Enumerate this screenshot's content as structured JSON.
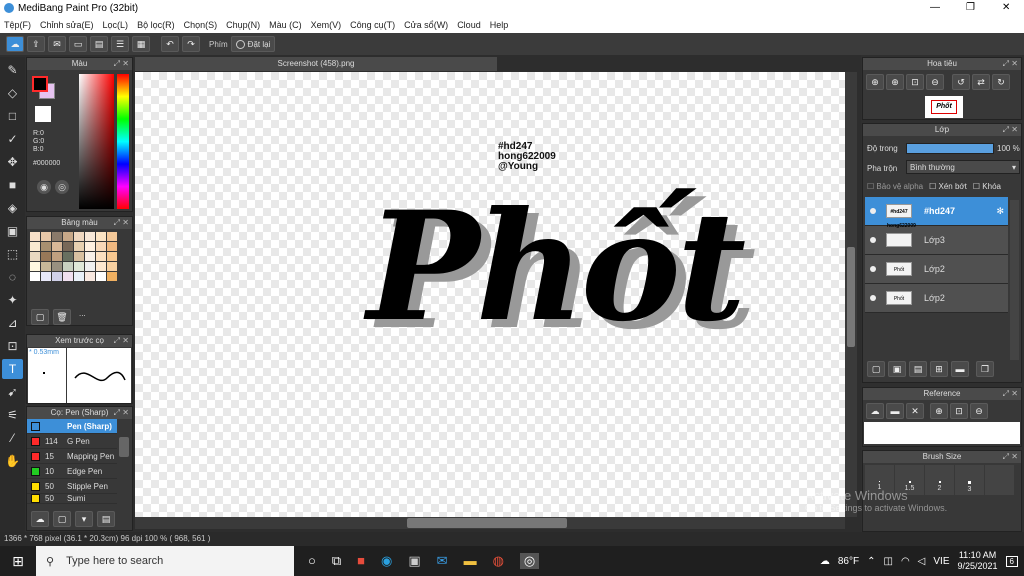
{
  "window": {
    "title": "MediBang Paint Pro (32bit)",
    "controls": [
      "—",
      "❐",
      "✕"
    ]
  },
  "menu": [
    "Tệp(F)",
    "Chỉnh sửa(E)",
    "Lọc(L)",
    "Bộ lọc(R)",
    "Chọn(S)",
    "Chụp(N)",
    "Màu (C)",
    "Xem(V)",
    "Công cụ(T)",
    "Cửa sổ(W)",
    "Cloud",
    "Help"
  ],
  "toolbar": {
    "shortcut_label": "Phím",
    "reset_label": "Đặt lại"
  },
  "color_panel": {
    "title": "Màu",
    "r": "R:0",
    "g": "G:0",
    "b": "B:0",
    "hex": "#000000"
  },
  "palette_panel": {
    "title": "Bảng màu",
    "more": "..."
  },
  "brush_preview": {
    "title": "Xem trước cọ",
    "size": "0.53mm"
  },
  "brush_panel": {
    "title": "Cọ: Pen (Sharp)",
    "items": [
      {
        "size": "",
        "name": "Pen (Sharp)",
        "color": "#ff2a2a"
      },
      {
        "size": "114",
        "name": "G Pen",
        "color": "#ff2a2a"
      },
      {
        "size": "15",
        "name": "Mapping Pen",
        "color": "#ff2a2a"
      },
      {
        "size": "10",
        "name": "Edge Pen",
        "color": "#22cc22"
      },
      {
        "size": "50",
        "name": "Stipple Pen",
        "color": "#ffdd00"
      },
      {
        "size": "50",
        "name": "Sumi",
        "color": "#ffdd00"
      }
    ]
  },
  "document": {
    "tab": "Screenshot (458).png",
    "credit_line1": "#hd247",
    "credit_line2": "hong622009",
    "credit_line3": "@Young",
    "artwork_text": "Phốt"
  },
  "navigator": {
    "title": "Hoa tiêu",
    "thumb_text": "Phốt"
  },
  "layer_panel": {
    "title": "Lớp",
    "opacity_label": "Độ trong",
    "opacity_value": "100 %",
    "opacity": 1.0,
    "blend_label": "Pha trộn",
    "blend_value": "Bình thường",
    "protect_alpha": "Bảo vệ alpha",
    "clipping": "Xén bớt",
    "lock": "Khóa",
    "layers": [
      {
        "name": "#hd247",
        "thumb": "#hd247 hong622009 @Young",
        "active": true
      },
      {
        "name": "Lớp3",
        "thumb": "",
        "active": false
      },
      {
        "name": "Lớp2",
        "thumb": "Phốt",
        "active": false
      },
      {
        "name": "Lớp2",
        "thumb": "Phốt",
        "active": false
      }
    ]
  },
  "reference_panel": {
    "title": "Reference"
  },
  "brush_size_panel": {
    "title": "Brush Size",
    "sizes": [
      "1",
      "1.5",
      "2",
      "3"
    ]
  },
  "watermark": {
    "line1": "Activate Windows",
    "line2": "Go to Settings to activate Windows."
  },
  "status": {
    "text": "1366 * 768 pixel   (36.1 * 20.3cm)   96 dpi   100 %   ( 968, 561 )"
  },
  "taskbar": {
    "search_placeholder": "Type here to search",
    "weather": "86°F",
    "lang": "VIE",
    "time": "11:10 AM",
    "date": "9/25/2021",
    "notif": "6"
  },
  "colors": {
    "accent": "#3d8fd8",
    "panel": "#383838",
    "taskbar": "#1f1f1f"
  }
}
